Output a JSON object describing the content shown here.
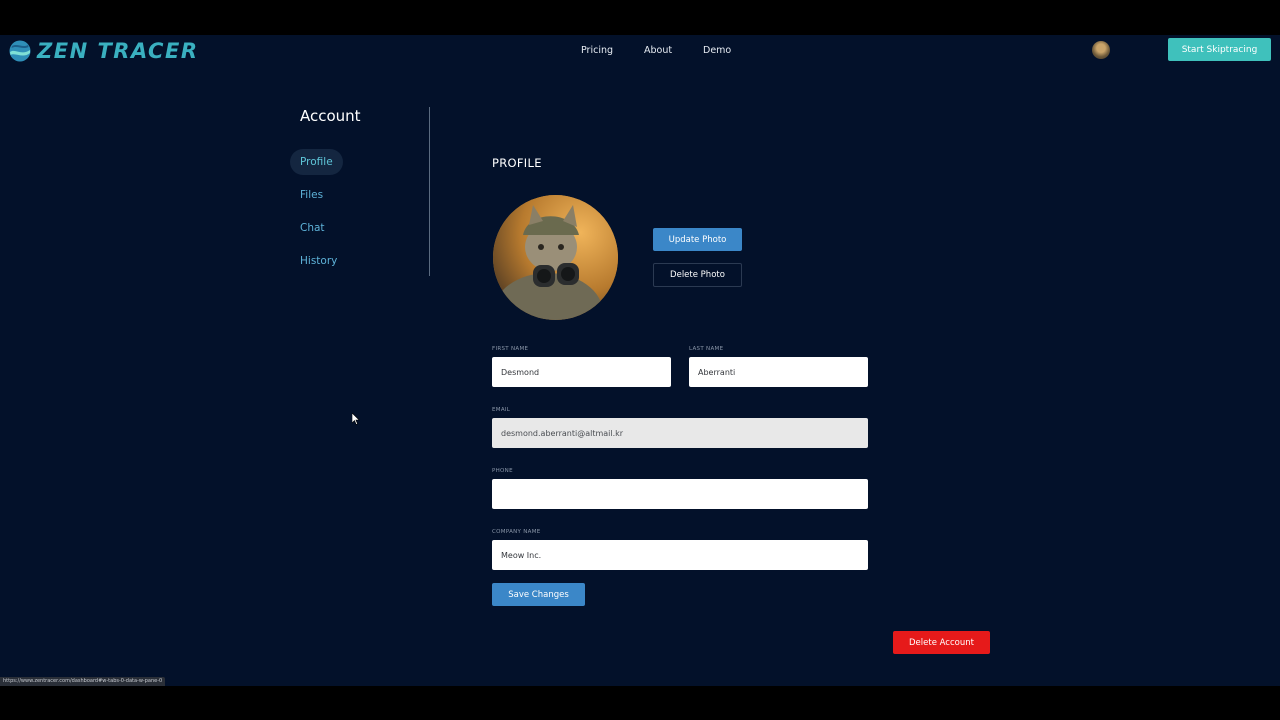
{
  "header": {
    "logo_text": "ZEN TRACER",
    "nav": [
      {
        "label": "Pricing"
      },
      {
        "label": "About"
      },
      {
        "label": "Demo"
      }
    ],
    "cta_label": "Start Skiptracing"
  },
  "sidebar": {
    "title": "Account",
    "items": [
      {
        "label": "Profile",
        "active": true
      },
      {
        "label": "Files",
        "active": false
      },
      {
        "label": "Chat",
        "active": false
      },
      {
        "label": "History",
        "active": false
      }
    ]
  },
  "profile": {
    "section_title": "PROFILE",
    "update_photo_label": "Update Photo",
    "delete_photo_label": "Delete Photo",
    "fields": {
      "first_name": {
        "label": "FIRST NAME",
        "value": "Desmond"
      },
      "last_name": {
        "label": "LAST NAME",
        "value": "Aberranti"
      },
      "email": {
        "label": "EMAIL",
        "value": "desmond.aberranti@altmail.kr"
      },
      "phone": {
        "label": "PHONE",
        "value": ""
      },
      "company": {
        "label": "COMPANY NAME",
        "value": "Meow Inc."
      }
    },
    "save_label": "Save Changes",
    "delete_account_label": "Delete Account"
  },
  "status_bar": {
    "url": "https://www.zentracer.com/dashboard#w-tabs-0-data-w-pane-0"
  },
  "colors": {
    "background": "#03112a",
    "accent_teal": "#3fc1bc",
    "primary_blue": "#3b87c8",
    "danger_red": "#e61a1a"
  }
}
